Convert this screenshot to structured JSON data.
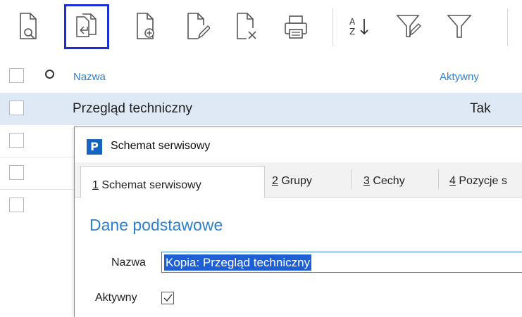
{
  "toolbar": {
    "buttons": [
      {
        "name": "preview-document-icon"
      },
      {
        "name": "copy-document-icon",
        "active": true
      },
      {
        "name": "add-document-icon"
      },
      {
        "name": "edit-document-icon"
      },
      {
        "name": "delete-document-icon"
      },
      {
        "name": "print-icon"
      },
      {
        "name": "sort-az-icon",
        "label": "A\nZ↓"
      },
      {
        "name": "edit-filter-icon"
      },
      {
        "name": "filter-icon"
      }
    ],
    "sort_label_a": "A",
    "sort_label_z": "Z",
    "sort_arrow": "↓"
  },
  "list": {
    "columns": {
      "name": "Nazwa",
      "active": "Aktywny"
    },
    "rows": [
      {
        "name": "Przegląd techniczny",
        "active": "Tak",
        "selected": true
      },
      {
        "name": "",
        "active": ""
      },
      {
        "name": "",
        "active": ""
      },
      {
        "name": "",
        "active": ""
      }
    ]
  },
  "dialog": {
    "title": "Schemat serwisowy",
    "logo": "P",
    "tabs": [
      {
        "key": "1",
        "label": " Schemat serwisowy",
        "active": true
      },
      {
        "key": "2",
        "label": " Grupy"
      },
      {
        "key": "3",
        "label": " Cechy"
      },
      {
        "key": "4",
        "label": " Pozycje s"
      }
    ],
    "section_title": "Dane podstawowe",
    "fields": {
      "name_label": "Nazwa",
      "name_value": "Kopia: Przegląd techniczny",
      "active_label": "Aktywny",
      "active_checked": true
    }
  },
  "colors": {
    "accent": "#2e80cf",
    "selection": "#dfe9f5",
    "highlight": "#1f5fd6",
    "active_button_border": "#1a2fd6"
  }
}
